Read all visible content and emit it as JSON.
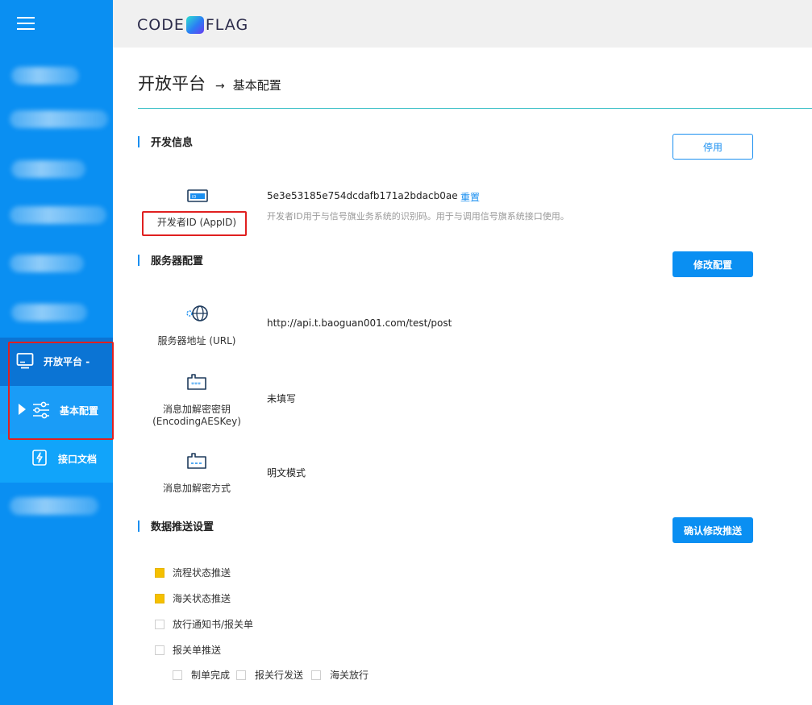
{
  "brand": {
    "logo_left": "CODE",
    "logo_right": "FLAG"
  },
  "sidebar": {
    "menu_icon": "hamburger-menu-icon",
    "parent": {
      "label": "开放平台",
      "suffix": "-",
      "icon": "monitor-icon"
    },
    "children": [
      {
        "label": "基本配置",
        "icon": "sliders-icon",
        "active": true
      },
      {
        "label": "接口文档",
        "icon": "api-document-icon"
      }
    ]
  },
  "page": {
    "breadcrumb_root": "开放平台",
    "breadcrumb_sep": "→",
    "breadcrumb_current": "基本配置"
  },
  "sections": {
    "dev_info": {
      "title": "开发信息",
      "button": "停用",
      "appid_label": "开发者ID (AppID)",
      "appid_value": "5e3e53185e754dcdafb171a2bdacb0ae",
      "reset_link": "重置",
      "appid_hint": "开发者ID用于与信号旗业务系统的识别码。用于与调用信号旗系统接口使用。"
    },
    "server_config": {
      "title": "服务器配置",
      "button": "修改配置",
      "url_label": "服务器地址 (URL)",
      "url_value": "http://api.t.baoguan001.com/test/post",
      "aeskey_label_1": "消息加解密密钥",
      "aeskey_label_2": "(EncodingAESKey)",
      "aeskey_value": "未填写",
      "mode_label": "消息加解密方式",
      "mode_value": "明文模式"
    },
    "push_settings": {
      "title": "数据推送设置",
      "button": "确认修改推送",
      "options": [
        {
          "label": "流程状态推送",
          "checked": true
        },
        {
          "label": "海关状态推送",
          "checked": true
        },
        {
          "label": "放行通知书/报关单",
          "checked": false
        },
        {
          "label": "报关单推送",
          "checked": false
        }
      ],
      "sub_options": [
        {
          "label": "制单完成",
          "checked": false
        },
        {
          "label": "报关行发送",
          "checked": false
        },
        {
          "label": "海关放行",
          "checked": false
        }
      ]
    }
  },
  "colors": {
    "sidebar": "#0a8ff2",
    "accent": "#1a8ff0",
    "checked": "#f5c000",
    "highlight": "#e02020"
  }
}
